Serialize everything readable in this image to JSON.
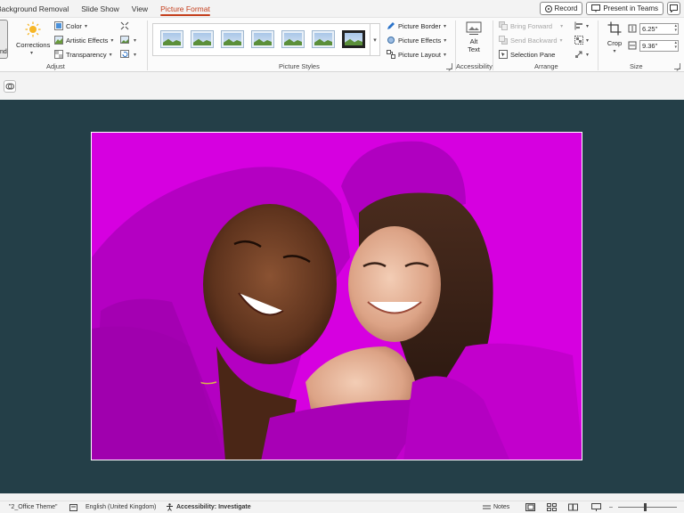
{
  "tabs": [
    {
      "label": "Background Removal",
      "active": false
    },
    {
      "label": "Slide Show",
      "active": false
    },
    {
      "label": "View",
      "active": false
    },
    {
      "label": "Picture Format",
      "active": true
    }
  ],
  "top_buttons": {
    "record": "Record",
    "present": "Present in Teams"
  },
  "ribbon": {
    "remove_bg_fragment": "nd",
    "adjust": {
      "label": "Adjust",
      "corrections": "Corrections",
      "color": "Color",
      "artistic_effects": "Artistic Effects",
      "transparency": "Transparency"
    },
    "picture_styles": {
      "label": "Picture Styles",
      "border": "Picture Border",
      "effects": "Picture Effects",
      "layout": "Picture Layout"
    },
    "accessibility": {
      "label": "Accessibility",
      "alt_text_line1": "Alt",
      "alt_text_line2": "Text"
    },
    "arrange": {
      "label": "Arrange",
      "bring_forward": "Bring Forward",
      "send_backward": "Send Backward",
      "selection_pane": "Selection Pane"
    },
    "size": {
      "label": "Size",
      "crop": "Crop",
      "height": "6.25\"",
      "width": "9.36\""
    }
  },
  "status": {
    "theme": "\"2_Office Theme\"",
    "language": "English (United Kingdom)",
    "accessibility": "Accessibility: Investigate",
    "notes": "Notes"
  },
  "colors": {
    "accent": "#c43e1c",
    "canvas_bg": "#243f48",
    "removal_mask": "#d600e0"
  }
}
